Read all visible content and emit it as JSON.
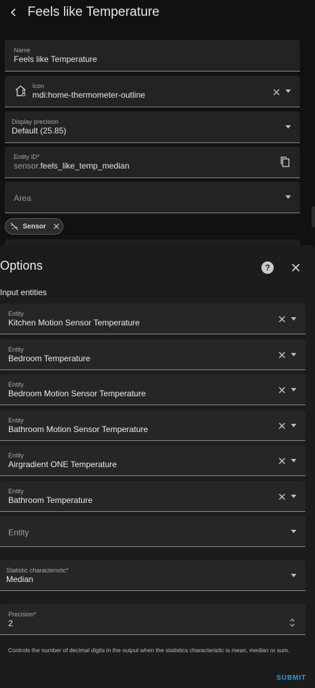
{
  "header": {
    "title": "Feels like Temperature"
  },
  "fields": {
    "name": {
      "label": "Name",
      "value": "Feels like Temperature"
    },
    "icon": {
      "label": "Icon",
      "value": "mdi:home-thermometer-outline",
      "icon_name": "home-thermometer-outline-icon"
    },
    "precision": {
      "label": "Display precision",
      "value": "Default (25.85)"
    },
    "entity_id": {
      "label": "Entity ID*",
      "prefix": "sensor.",
      "value": "feels_like_temp_median"
    },
    "area": {
      "placeholder": "Area"
    }
  },
  "chip": {
    "label": "Sensor"
  },
  "dialog": {
    "title": "Options",
    "section_label": "Input entities",
    "entities": [
      {
        "label": "Entity",
        "value": "Kitchen Motion Sensor Temperature"
      },
      {
        "label": "Entity",
        "value": "Bedroom Temperature"
      },
      {
        "label": "Entity",
        "value": "Bedroom Motion Sensor Temperature"
      },
      {
        "label": "Entity",
        "value": "Bathroom Motion Sensor Temperature"
      },
      {
        "label": "Entity",
        "value": "Airgradient ONE Temperature"
      },
      {
        "label": "Entity",
        "value": "Bathroom Temperature"
      }
    ],
    "empty_entity": {
      "placeholder": "Entity"
    },
    "statistic": {
      "label": "Statistic characteristic*",
      "value": "Median"
    },
    "precision": {
      "label": "Precision*",
      "value": "2"
    },
    "helper_text": "Controls the number of decimal digits in the output when the statistics characteristic is mean, median or sum.",
    "submit_label": "SUBMIT",
    "help_icon_glyph": "?"
  },
  "colors": {
    "accent": "#1e9fe6",
    "background": "#111111",
    "field": "#232323",
    "dialog": "#1c1c1c"
  }
}
